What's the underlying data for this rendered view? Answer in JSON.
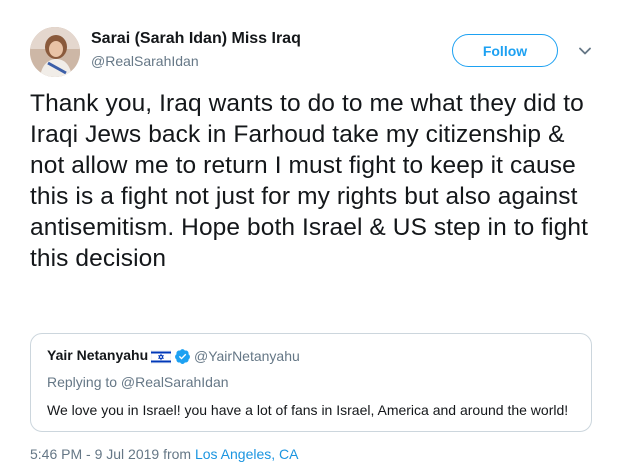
{
  "author": {
    "name": "Sarai (Sarah Idan) Miss Iraq",
    "handle": "@RealSarahIdan",
    "avatar_icon": "profile-photo"
  },
  "actions": {
    "follow_label": "Follow",
    "more_icon": "chevron-down-icon"
  },
  "tweet": {
    "text": "Thank you, Iraq wants to do to me what they did to Iraqi Jews back in Farhoud take my citizenship & not allow me to return I must fight to keep it cause this is a fight not just for my rights but also against antisemitism. Hope both Israel & US step in to fight this decision"
  },
  "quote": {
    "name": "Yair Netanyahu",
    "flag_icon": "israel-flag-icon",
    "verified_icon": "verified-badge-icon",
    "handle": "@YairNetanyahu",
    "replying": "Replying to @RealSarahIdan",
    "text": "We love you in Israel! you have a lot of fans in Israel, America and around the world!"
  },
  "meta": {
    "time_prefix": "5:46 PM - 9 Jul 2019 from ",
    "location": "Los Angeles, CA"
  },
  "colors": {
    "accent": "#1da1f2",
    "link": "#1b95e0",
    "secondary_text": "#657786",
    "border": "#ccd6dd"
  }
}
